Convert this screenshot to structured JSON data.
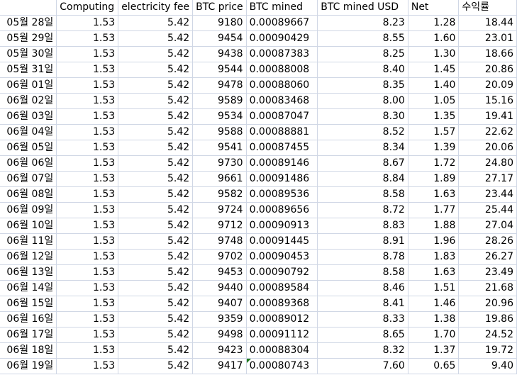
{
  "sheet": {
    "headers": [
      "",
      "Computing",
      "electricity fee",
      "BTC price",
      "BTC mined",
      "BTC mined USD",
      "Net",
      "수익률"
    ],
    "rows": [
      [
        "05월 28일",
        "1.53",
        "5.42",
        "9180",
        "0.00089667",
        "8.23",
        "1.28",
        "18.44"
      ],
      [
        "05월 29일",
        "1.53",
        "5.42",
        "9454",
        "0.00090429",
        "8.55",
        "1.60",
        "23.01"
      ],
      [
        "05월 30일",
        "1.53",
        "5.42",
        "9438",
        "0.00087383",
        "8.25",
        "1.30",
        "18.66"
      ],
      [
        "05월 31일",
        "1.53",
        "5.42",
        "9544",
        "0.00088008",
        "8.40",
        "1.45",
        "20.86"
      ],
      [
        "06월 01일",
        "1.53",
        "5.42",
        "9478",
        "0.00088060",
        "8.35",
        "1.40",
        "20.09"
      ],
      [
        "06월 02일",
        "1.53",
        "5.42",
        "9589",
        "0.00083468",
        "8.00",
        "1.05",
        "15.16"
      ],
      [
        "06월 03일",
        "1.53",
        "5.42",
        "9534",
        "0.00087047",
        "8.30",
        "1.35",
        "19.41"
      ],
      [
        "06월 04일",
        "1.53",
        "5.42",
        "9588",
        "0.00088881",
        "8.52",
        "1.57",
        "22.62"
      ],
      [
        "06월 05일",
        "1.53",
        "5.42",
        "9541",
        "0.00087455",
        "8.34",
        "1.39",
        "20.06"
      ],
      [
        "06월 06일",
        "1.53",
        "5.42",
        "9730",
        "0.00089146",
        "8.67",
        "1.72",
        "24.80"
      ],
      [
        "06월 07일",
        "1.53",
        "5.42",
        "9661",
        "0.00091486",
        "8.84",
        "1.89",
        "27.17"
      ],
      [
        "06월 08일",
        "1.53",
        "5.42",
        "9582",
        "0.00089536",
        "8.58",
        "1.63",
        "23.44"
      ],
      [
        "06월 09일",
        "1.53",
        "5.42",
        "9724",
        "0.00089656",
        "8.72",
        "1.77",
        "25.44"
      ],
      [
        "06월 10일",
        "1.53",
        "5.42",
        "9712",
        "0.00090913",
        "8.83",
        "1.88",
        "27.04"
      ],
      [
        "06월 11일",
        "1.53",
        "5.42",
        "9748",
        "0.00091445",
        "8.91",
        "1.96",
        "28.26"
      ],
      [
        "06월 12일",
        "1.53",
        "5.42",
        "9702",
        "0.00090453",
        "8.78",
        "1.83",
        "26.27"
      ],
      [
        "06월 13일",
        "1.53",
        "5.42",
        "9453",
        "0.00090792",
        "8.58",
        "1.63",
        "23.49"
      ],
      [
        "06월 14일",
        "1.53",
        "5.42",
        "9440",
        "0.00089584",
        "8.46",
        "1.51",
        "21.68"
      ],
      [
        "06월 15일",
        "1.53",
        "5.42",
        "9407",
        "0.00089368",
        "8.41",
        "1.46",
        "20.96"
      ],
      [
        "06월 16일",
        "1.53",
        "5.42",
        "9359",
        "0.00089012",
        "8.33",
        "1.38",
        "19.86"
      ],
      [
        "06월 17일",
        "1.53",
        "5.42",
        "9498",
        "0.00091112",
        "8.65",
        "1.70",
        "24.52"
      ],
      [
        "06월 18일",
        "1.53",
        "5.42",
        "9423",
        "0.00088304",
        "8.32",
        "1.37",
        "19.72"
      ],
      [
        "06월 19일",
        "1.53",
        "5.42",
        "9417",
        "0.00080743",
        "7.60",
        "0.65",
        "9.40"
      ]
    ],
    "error_indicator_cell": {
      "row": 22,
      "col": 4,
      "color": "#1e7b1e"
    }
  }
}
